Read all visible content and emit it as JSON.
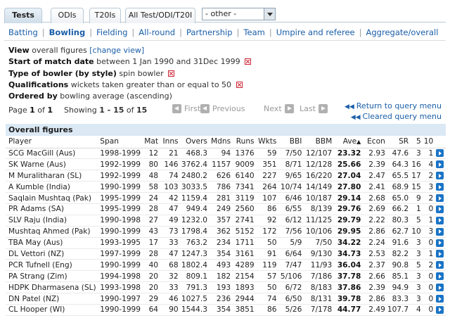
{
  "tabs": [
    {
      "label": "Tests",
      "active": true
    },
    {
      "label": "ODIs",
      "active": false
    },
    {
      "label": "T20Is",
      "active": false
    },
    {
      "label": "All Test/ODI/T20I",
      "active": false
    }
  ],
  "format_select": {
    "value": "- other -"
  },
  "subnav": [
    "Batting",
    "Bowling",
    "Fielding",
    "All-round",
    "Partnership",
    "Team",
    "Umpire and referee",
    "Aggregate/overall"
  ],
  "subnav_active": "Bowling",
  "query": {
    "view_label": "View",
    "view_value": "overall figures",
    "change_view": "[change view]",
    "start_label": "Start of match date",
    "start_value": "between 1 Jan 1990 and 31Dec 1999",
    "type_label": "Type of bowler (by style)",
    "type_value": "spin bowler",
    "qual_label": "Qualifications",
    "qual_value": "wickets taken greater than or equal to 50",
    "order_label": "Ordered by",
    "order_value": "bowling average (ascending)"
  },
  "pager": {
    "page_prefix": "Page",
    "page": "1",
    "of": "of",
    "total_pages": "1",
    "showing_prefix": "Showing",
    "showing_range": "1 - 15",
    "total_rows": "15",
    "first": "First",
    "previous": "Previous",
    "next": "Next",
    "last": "Last"
  },
  "query_links": {
    "return": "Return to query menu",
    "cleared": "Cleared query menu"
  },
  "table": {
    "caption": "Overall figures",
    "headers": [
      "Player",
      "Span",
      "Mat",
      "Inns",
      "Overs",
      "Mdns",
      "Runs",
      "Wkts",
      "BBI",
      "BBM",
      "Ave",
      "Econ",
      "SR",
      "5",
      "10"
    ],
    "rows": [
      [
        "SCG MacGill (Aus)",
        "1998-1999",
        "12",
        "21",
        "468.3",
        "94",
        "1376",
        "59",
        "7/50",
        "12/107",
        "23.32",
        "2.93",
        "47.6",
        "3",
        "1"
      ],
      [
        "SK Warne (Aus)",
        "1992-1999",
        "80",
        "146",
        "3762.4",
        "1157",
        "9009",
        "351",
        "8/71",
        "12/128",
        "25.66",
        "2.39",
        "64.3",
        "16",
        "4"
      ],
      [
        "M Muralitharan (SL)",
        "1992-1999",
        "48",
        "74",
        "2480.2",
        "626",
        "6140",
        "227",
        "9/65",
        "16/220",
        "27.04",
        "2.47",
        "65.5",
        "17",
        "2"
      ],
      [
        "A Kumble (India)",
        "1990-1999",
        "58",
        "103",
        "3033.5",
        "786",
        "7341",
        "264",
        "10/74",
        "14/149",
        "27.80",
        "2.41",
        "68.9",
        "15",
        "3"
      ],
      [
        "Saqlain Mushtaq (Pak)",
        "1995-1999",
        "24",
        "42",
        "1159.4",
        "281",
        "3119",
        "107",
        "6/46",
        "10/187",
        "29.14",
        "2.68",
        "65.0",
        "9",
        "2"
      ],
      [
        "PR Adams (SA)",
        "1995-1999",
        "28",
        "47",
        "949.4",
        "249",
        "2560",
        "86",
        "6/55",
        "8/139",
        "29.76",
        "2.69",
        "66.2",
        "1",
        "0"
      ],
      [
        "SLV Raju (India)",
        "1990-1998",
        "27",
        "49",
        "1232.0",
        "357",
        "2741",
        "92",
        "6/12",
        "11/125",
        "29.79",
        "2.22",
        "80.3",
        "5",
        "1"
      ],
      [
        "Mushtaq Ahmed (Pak)",
        "1990-1999",
        "43",
        "73",
        "1798.4",
        "362",
        "5152",
        "172",
        "7/56",
        "10/106",
        "29.95",
        "2.86",
        "62.7",
        "10",
        "3"
      ],
      [
        "TBA May (Aus)",
        "1993-1995",
        "17",
        "33",
        "763.2",
        "234",
        "1711",
        "50",
        "5/9",
        "7/50",
        "34.22",
        "2.24",
        "91.6",
        "3",
        "0"
      ],
      [
        "DL Vettori (NZ)",
        "1997-1999",
        "28",
        "47",
        "1247.3",
        "354",
        "3161",
        "91",
        "6/64",
        "9/130",
        "34.73",
        "2.53",
        "82.2",
        "3",
        "1"
      ],
      [
        "PCR Tufnell (Eng)",
        "1990-1999",
        "40",
        "68",
        "1802.4",
        "493",
        "4289",
        "119",
        "7/47",
        "11/93",
        "36.04",
        "2.37",
        "90.8",
        "5",
        "2"
      ],
      [
        "PA Strang (Zim)",
        "1994-1998",
        "20",
        "32",
        "809.1",
        "182",
        "2154",
        "57",
        "5/106",
        "7/186",
        "37.78",
        "2.66",
        "85.1",
        "3",
        "0"
      ],
      [
        "HDPK Dharmasena (SL)",
        "1993-1998",
        "20",
        "33",
        "791.3",
        "193",
        "1893",
        "50",
        "6/72",
        "8/183",
        "37.86",
        "2.39",
        "94.9",
        "3",
        "0"
      ],
      [
        "DN Patel (NZ)",
        "1990-1997",
        "29",
        "46",
        "1027.5",
        "236",
        "2944",
        "74",
        "6/50",
        "8/131",
        "39.78",
        "2.86",
        "83.3",
        "3",
        "0"
      ],
      [
        "CL Hooper (WI)",
        "1990-1999",
        "64",
        "90",
        "1544.3",
        "354",
        "3851",
        "86",
        "5/26",
        "7/178",
        "44.77",
        "2.49",
        "107.7",
        "4",
        "0"
      ]
    ]
  }
}
